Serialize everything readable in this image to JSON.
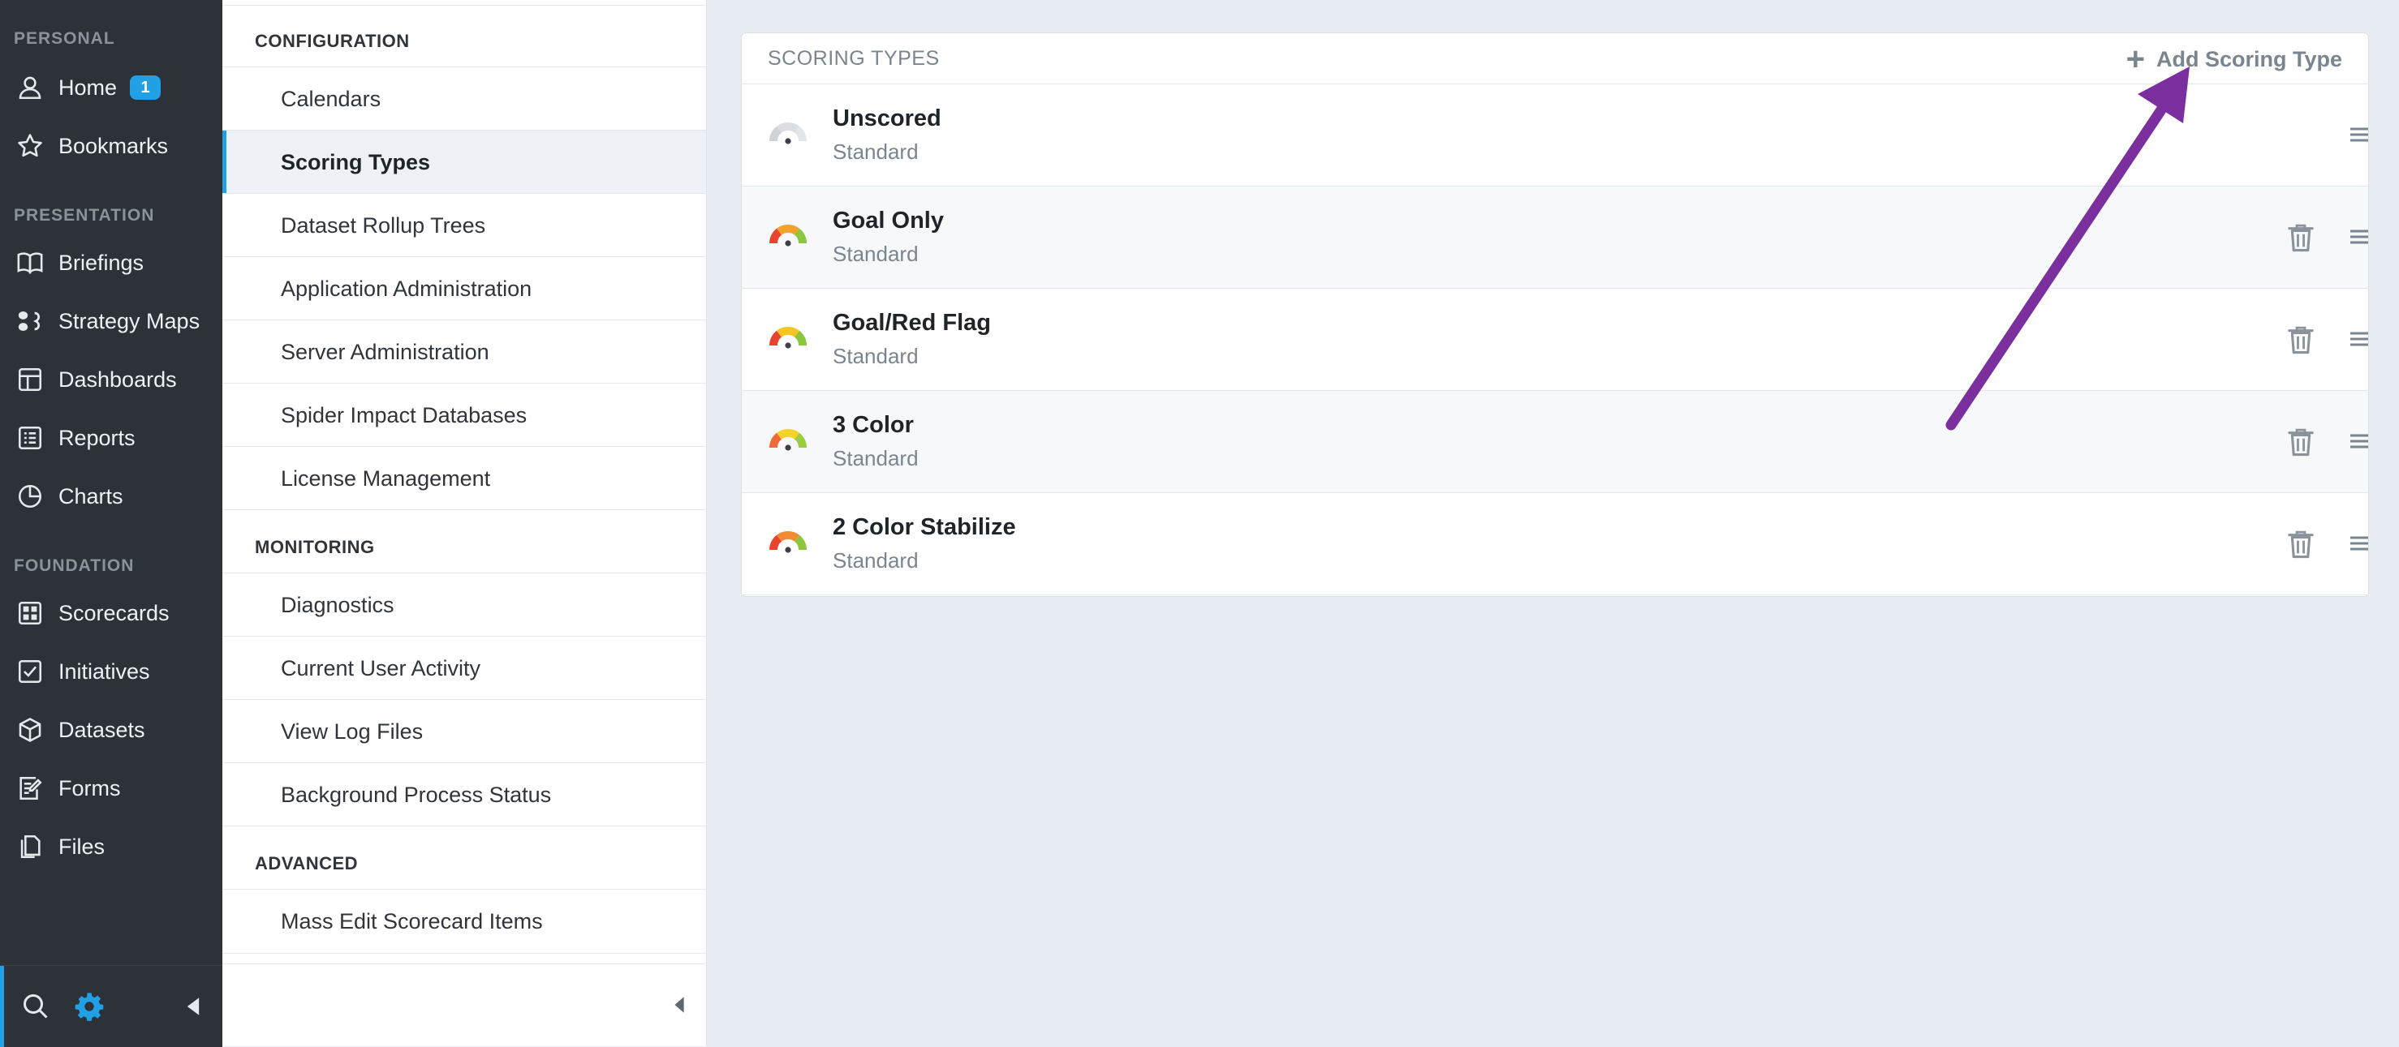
{
  "nav": {
    "sections": [
      {
        "label": "PERSONAL"
      },
      {
        "label": "PRESENTATION"
      },
      {
        "label": "FOUNDATION"
      }
    ],
    "items": [
      {
        "label": "Home",
        "icon": "user-icon",
        "badge": "1"
      },
      {
        "label": "Bookmarks",
        "icon": "star-icon"
      },
      {
        "label": "Briefings",
        "icon": "book-icon"
      },
      {
        "label": "Strategy Maps",
        "icon": "strategy-map-icon"
      },
      {
        "label": "Dashboards",
        "icon": "dashboard-icon"
      },
      {
        "label": "Reports",
        "icon": "report-icon"
      },
      {
        "label": "Charts",
        "icon": "pie-chart-icon"
      },
      {
        "label": "Scorecards",
        "icon": "scorecard-icon"
      },
      {
        "label": "Initiatives",
        "icon": "checkbox-icon"
      },
      {
        "label": "Datasets",
        "icon": "cube-icon"
      },
      {
        "label": "Forms",
        "icon": "form-icon"
      },
      {
        "label": "Files",
        "icon": "files-icon"
      }
    ],
    "footer": {
      "search_icon": "search-icon",
      "settings_icon": "gear-icon",
      "collapse_icon": "caret-left-icon"
    },
    "accent_color": "#21a0e6"
  },
  "admin_menu": {
    "configuration_heading": "CONFIGURATION",
    "configuration_items": [
      "Calendars",
      "Scoring Types",
      "Dataset Rollup Trees",
      "Application Administration",
      "Server Administration",
      "Spider Impact Databases",
      "License Management"
    ],
    "active_item": "Scoring Types",
    "monitoring_heading": "MONITORING",
    "monitoring_items": [
      "Diagnostics",
      "Current User Activity",
      "View Log Files",
      "Background Process Status"
    ],
    "advanced_heading": "ADVANCED",
    "advanced_items": [
      "Mass Edit Scorecard Items"
    ]
  },
  "scoring_types": {
    "title": "SCORING TYPES",
    "add_label": "Add Scoring Type",
    "rows": [
      {
        "name": "Unscored",
        "type": "Standard",
        "gauge": [
          "#cfd3d8",
          "#dadde1",
          "#e3e6e9"
        ],
        "deletable": false
      },
      {
        "name": "Goal Only",
        "type": "Standard",
        "gauge": [
          "#e8432e",
          "#f0a22c",
          "#8cc63e"
        ],
        "deletable": true
      },
      {
        "name": "Goal/Red Flag",
        "type": "Standard",
        "gauge": [
          "#e8432e",
          "#f5c523",
          "#8cc63e"
        ],
        "deletable": true
      },
      {
        "name": "3 Color",
        "type": "Standard",
        "gauge": [
          "#f06a3a",
          "#f5d327",
          "#9ccc43"
        ],
        "deletable": true
      },
      {
        "name": "2 Color Stabilize",
        "type": "Standard",
        "gauge": [
          "#e8432e",
          "#f08a33",
          "#8cc63e"
        ],
        "deletable": true
      }
    ]
  },
  "annotation": {
    "arrow_color": "#7b2f9e"
  }
}
